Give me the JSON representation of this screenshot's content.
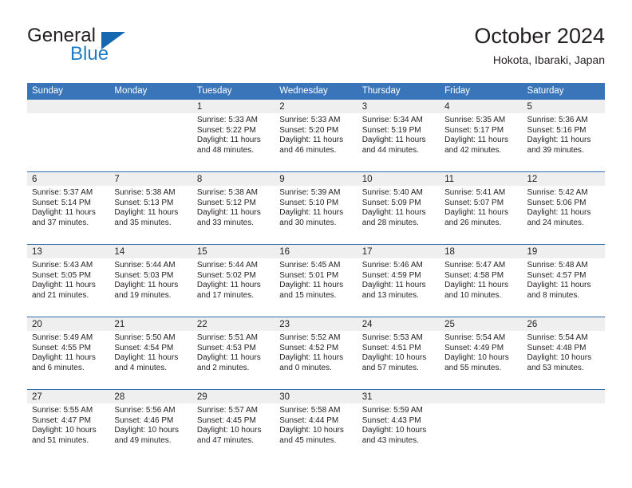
{
  "brand": {
    "name_top": "General",
    "name_bottom": "Blue",
    "accent_color": "#1d7cc4",
    "triangle_color": "#1668b0"
  },
  "header": {
    "title": "October 2024",
    "subtitle": "Hokota, Ibaraki, Japan"
  },
  "theme": {
    "header_bg": "#3a75b9",
    "row_divider": "#2f6cad",
    "daynum_band": "#efefef",
    "text": "#231f20"
  },
  "calendar": {
    "weekday_headers": [
      "Sunday",
      "Monday",
      "Tuesday",
      "Wednesday",
      "Thursday",
      "Friday",
      "Saturday"
    ],
    "weeks": [
      [
        {
          "day": "",
          "sunrise": "",
          "sunset": "",
          "daylight": "",
          "empty": true
        },
        {
          "day": "",
          "sunrise": "",
          "sunset": "",
          "daylight": "",
          "empty": true
        },
        {
          "day": "1",
          "sunrise": "Sunrise: 5:33 AM",
          "sunset": "Sunset: 5:22 PM",
          "daylight": "Daylight: 11 hours and 48 minutes."
        },
        {
          "day": "2",
          "sunrise": "Sunrise: 5:33 AM",
          "sunset": "Sunset: 5:20 PM",
          "daylight": "Daylight: 11 hours and 46 minutes."
        },
        {
          "day": "3",
          "sunrise": "Sunrise: 5:34 AM",
          "sunset": "Sunset: 5:19 PM",
          "daylight": "Daylight: 11 hours and 44 minutes."
        },
        {
          "day": "4",
          "sunrise": "Sunrise: 5:35 AM",
          "sunset": "Sunset: 5:17 PM",
          "daylight": "Daylight: 11 hours and 42 minutes."
        },
        {
          "day": "5",
          "sunrise": "Sunrise: 5:36 AM",
          "sunset": "Sunset: 5:16 PM",
          "daylight": "Daylight: 11 hours and 39 minutes."
        }
      ],
      [
        {
          "day": "6",
          "sunrise": "Sunrise: 5:37 AM",
          "sunset": "Sunset: 5:14 PM",
          "daylight": "Daylight: 11 hours and 37 minutes."
        },
        {
          "day": "7",
          "sunrise": "Sunrise: 5:38 AM",
          "sunset": "Sunset: 5:13 PM",
          "daylight": "Daylight: 11 hours and 35 minutes."
        },
        {
          "day": "8",
          "sunrise": "Sunrise: 5:38 AM",
          "sunset": "Sunset: 5:12 PM",
          "daylight": "Daylight: 11 hours and 33 minutes."
        },
        {
          "day": "9",
          "sunrise": "Sunrise: 5:39 AM",
          "sunset": "Sunset: 5:10 PM",
          "daylight": "Daylight: 11 hours and 30 minutes."
        },
        {
          "day": "10",
          "sunrise": "Sunrise: 5:40 AM",
          "sunset": "Sunset: 5:09 PM",
          "daylight": "Daylight: 11 hours and 28 minutes."
        },
        {
          "day": "11",
          "sunrise": "Sunrise: 5:41 AM",
          "sunset": "Sunset: 5:07 PM",
          "daylight": "Daylight: 11 hours and 26 minutes."
        },
        {
          "day": "12",
          "sunrise": "Sunrise: 5:42 AM",
          "sunset": "Sunset: 5:06 PM",
          "daylight": "Daylight: 11 hours and 24 minutes."
        }
      ],
      [
        {
          "day": "13",
          "sunrise": "Sunrise: 5:43 AM",
          "sunset": "Sunset: 5:05 PM",
          "daylight": "Daylight: 11 hours and 21 minutes."
        },
        {
          "day": "14",
          "sunrise": "Sunrise: 5:44 AM",
          "sunset": "Sunset: 5:03 PM",
          "daylight": "Daylight: 11 hours and 19 minutes."
        },
        {
          "day": "15",
          "sunrise": "Sunrise: 5:44 AM",
          "sunset": "Sunset: 5:02 PM",
          "daylight": "Daylight: 11 hours and 17 minutes."
        },
        {
          "day": "16",
          "sunrise": "Sunrise: 5:45 AM",
          "sunset": "Sunset: 5:01 PM",
          "daylight": "Daylight: 11 hours and 15 minutes."
        },
        {
          "day": "17",
          "sunrise": "Sunrise: 5:46 AM",
          "sunset": "Sunset: 4:59 PM",
          "daylight": "Daylight: 11 hours and 13 minutes."
        },
        {
          "day": "18",
          "sunrise": "Sunrise: 5:47 AM",
          "sunset": "Sunset: 4:58 PM",
          "daylight": "Daylight: 11 hours and 10 minutes."
        },
        {
          "day": "19",
          "sunrise": "Sunrise: 5:48 AM",
          "sunset": "Sunset: 4:57 PM",
          "daylight": "Daylight: 11 hours and 8 minutes."
        }
      ],
      [
        {
          "day": "20",
          "sunrise": "Sunrise: 5:49 AM",
          "sunset": "Sunset: 4:55 PM",
          "daylight": "Daylight: 11 hours and 6 minutes."
        },
        {
          "day": "21",
          "sunrise": "Sunrise: 5:50 AM",
          "sunset": "Sunset: 4:54 PM",
          "daylight": "Daylight: 11 hours and 4 minutes."
        },
        {
          "day": "22",
          "sunrise": "Sunrise: 5:51 AM",
          "sunset": "Sunset: 4:53 PM",
          "daylight": "Daylight: 11 hours and 2 minutes."
        },
        {
          "day": "23",
          "sunrise": "Sunrise: 5:52 AM",
          "sunset": "Sunset: 4:52 PM",
          "daylight": "Daylight: 11 hours and 0 minutes."
        },
        {
          "day": "24",
          "sunrise": "Sunrise: 5:53 AM",
          "sunset": "Sunset: 4:51 PM",
          "daylight": "Daylight: 10 hours and 57 minutes."
        },
        {
          "day": "25",
          "sunrise": "Sunrise: 5:54 AM",
          "sunset": "Sunset: 4:49 PM",
          "daylight": "Daylight: 10 hours and 55 minutes."
        },
        {
          "day": "26",
          "sunrise": "Sunrise: 5:54 AM",
          "sunset": "Sunset: 4:48 PM",
          "daylight": "Daylight: 10 hours and 53 minutes."
        }
      ],
      [
        {
          "day": "27",
          "sunrise": "Sunrise: 5:55 AM",
          "sunset": "Sunset: 4:47 PM",
          "daylight": "Daylight: 10 hours and 51 minutes."
        },
        {
          "day": "28",
          "sunrise": "Sunrise: 5:56 AM",
          "sunset": "Sunset: 4:46 PM",
          "daylight": "Daylight: 10 hours and 49 minutes."
        },
        {
          "day": "29",
          "sunrise": "Sunrise: 5:57 AM",
          "sunset": "Sunset: 4:45 PM",
          "daylight": "Daylight: 10 hours and 47 minutes."
        },
        {
          "day": "30",
          "sunrise": "Sunrise: 5:58 AM",
          "sunset": "Sunset: 4:44 PM",
          "daylight": "Daylight: 10 hours and 45 minutes."
        },
        {
          "day": "31",
          "sunrise": "Sunrise: 5:59 AM",
          "sunset": "Sunset: 4:43 PM",
          "daylight": "Daylight: 10 hours and 43 minutes."
        },
        {
          "day": "",
          "sunrise": "",
          "sunset": "",
          "daylight": "",
          "empty": true
        },
        {
          "day": "",
          "sunrise": "",
          "sunset": "",
          "daylight": "",
          "empty": true
        }
      ]
    ]
  }
}
